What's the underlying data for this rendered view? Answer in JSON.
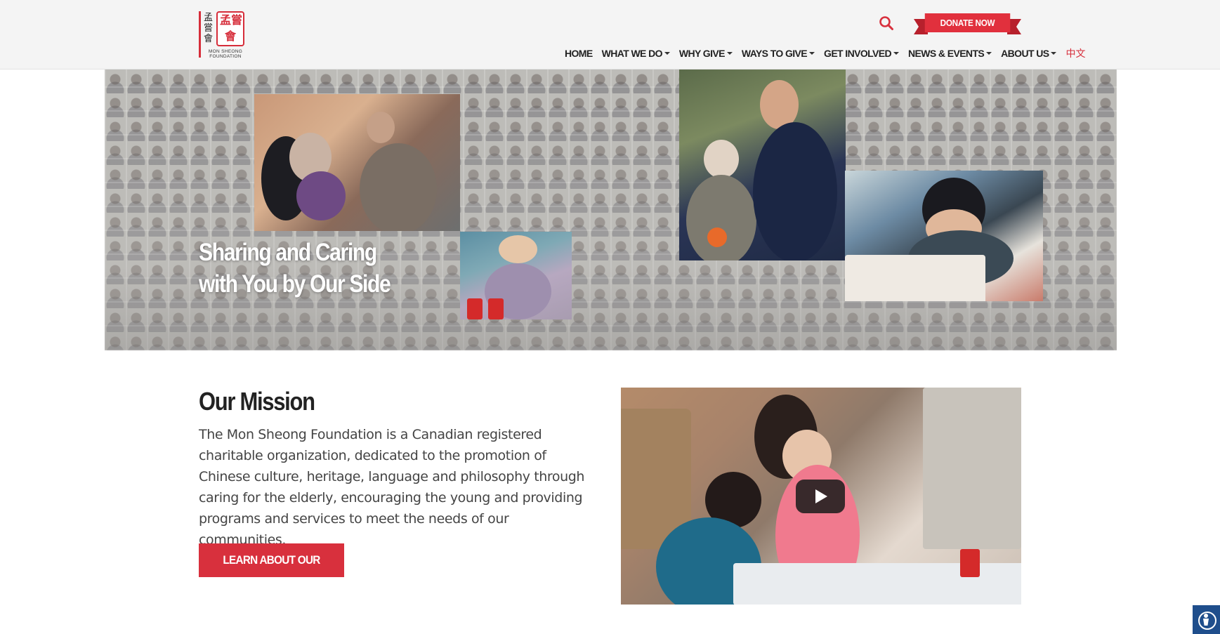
{
  "header": {
    "logo": {
      "chinese_chars": "孟嘗會",
      "seal_text": "孟嘗會",
      "org_line1": "MON SHEONG",
      "org_line2": "FOUNDATION"
    },
    "search_icon": "search-icon",
    "donate_label": "DONATE NOW",
    "nav": [
      {
        "label": "HOME",
        "dropdown": false
      },
      {
        "label": "WHAT WE DO",
        "dropdown": true
      },
      {
        "label": "WHY GIVE",
        "dropdown": true
      },
      {
        "label": "WAYS TO GIVE",
        "dropdown": true
      },
      {
        "label": "GET INVOLVED",
        "dropdown": true
      },
      {
        "label": "NEWS & EVENTS",
        "dropdown": true
      },
      {
        "label": "ABOUT US",
        "dropdown": true
      }
    ],
    "language_label": "中文"
  },
  "hero": {
    "title_line1": "Sharing and Caring",
    "title_line2": "with You by Our Side"
  },
  "mission": {
    "title": "Our Mission",
    "text": "The Mon Sheong Foundation is a Canadian registered charitable organization, dedicated to the promotion of Chinese culture, heritage, language and philosophy through caring for the elderly, encouraging the young and providing programs and services to meet the needs of our communities.",
    "button_label": "LEARN ABOUT OUR WORK",
    "video_icon": "play-icon"
  },
  "accessibility_icon": "accessibility-icon",
  "colors": {
    "brand_red": "#d8303d",
    "header_bg": "#f4f4f4",
    "accessibility_blue": "#1f4e8c"
  }
}
